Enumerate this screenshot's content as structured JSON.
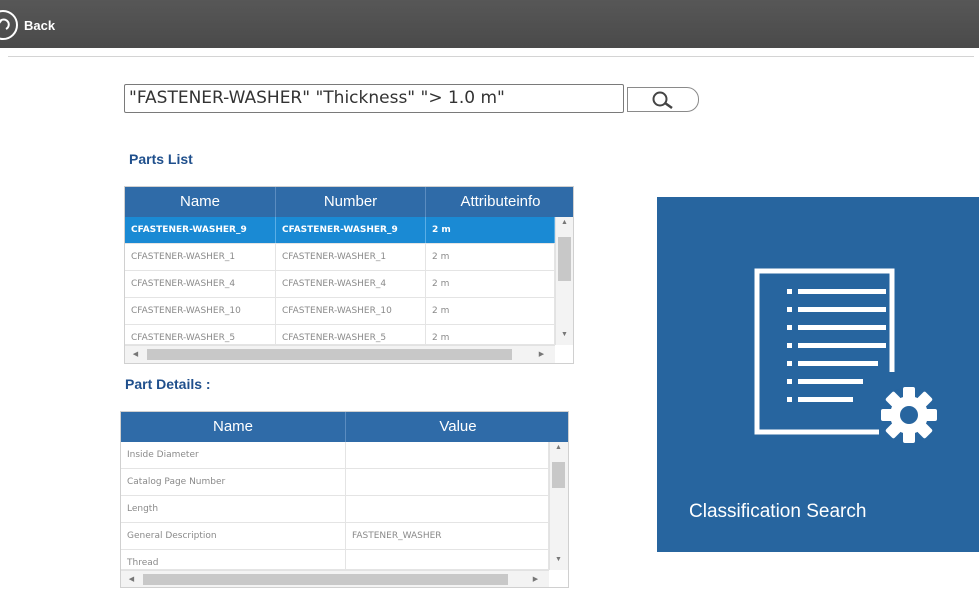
{
  "header": {
    "back_label": "Back"
  },
  "search": {
    "query": "\"FASTENER-WASHER\" \"Thickness\" \"> 1.0 m\""
  },
  "parts_list": {
    "title": "Parts List",
    "columns": [
      "Name",
      "Number",
      "Attributeinfo"
    ],
    "rows": [
      [
        "CFASTENER-WASHER_9",
        "CFASTENER-WASHER_9",
        "2 m"
      ],
      [
        "CFASTENER-WASHER_1",
        "CFASTENER-WASHER_1",
        "2 m"
      ],
      [
        "CFASTENER-WASHER_4",
        "CFASTENER-WASHER_4",
        "2 m"
      ],
      [
        "CFASTENER-WASHER_10",
        "CFASTENER-WASHER_10",
        "2 m"
      ],
      [
        "CFASTENER-WASHER_5",
        "CFASTENER-WASHER_5",
        "2 m"
      ]
    ],
    "selected_row": 0
  },
  "part_details": {
    "title": "Part Details :",
    "columns": [
      "Name",
      "Value"
    ],
    "rows": [
      [
        "Inside Diameter",
        ""
      ],
      [
        "Catalog Page Number",
        ""
      ],
      [
        "Length",
        ""
      ],
      [
        "General Description",
        "FASTENER_WASHER"
      ],
      [
        "Thread",
        ""
      ]
    ]
  },
  "tile": {
    "label": "Classification Search",
    "icon": "document-list-gear-icon"
  },
  "colors": {
    "topbar": "#4f4f4f",
    "accent": "#2f6ba8",
    "selection": "#1a8ad4",
    "tile": "#27659f"
  }
}
